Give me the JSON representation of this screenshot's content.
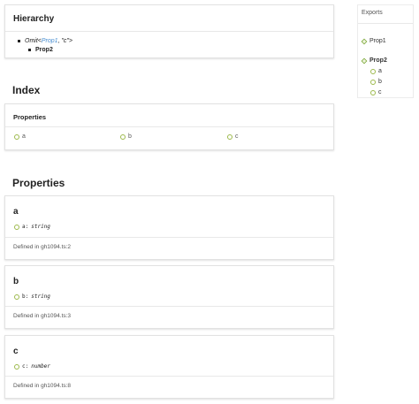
{
  "hierarchy": {
    "title": "Hierarchy",
    "omit_prefix": "Omit<",
    "omit_link": "Prop1",
    "omit_suffix": ", \"c\">",
    "child": "Prop2"
  },
  "headings": {
    "index": "Index",
    "properties": "Properties"
  },
  "index": {
    "title": "Properties",
    "items": [
      "a",
      "b",
      "c"
    ]
  },
  "properties": [
    {
      "name": "a",
      "sig_name": "a:",
      "sig_type": "string",
      "defined": "Defined in gh1094.ts:2"
    },
    {
      "name": "b",
      "sig_name": "b:",
      "sig_type": "string",
      "defined": "Defined in gh1094.ts:3"
    },
    {
      "name": "c",
      "sig_name": "c:",
      "sig_type": "number",
      "defined": "Defined in gh1094.ts:8"
    }
  ],
  "sidebar": {
    "title": "Exports",
    "items": [
      {
        "label": "Prop1"
      },
      {
        "label": "Prop2",
        "children": [
          "a",
          "b",
          "c"
        ]
      }
    ]
  },
  "colors": {
    "property_circle": "#9cb94a",
    "link": "#4a8fd1",
    "interface_icon": "#7da83c"
  }
}
